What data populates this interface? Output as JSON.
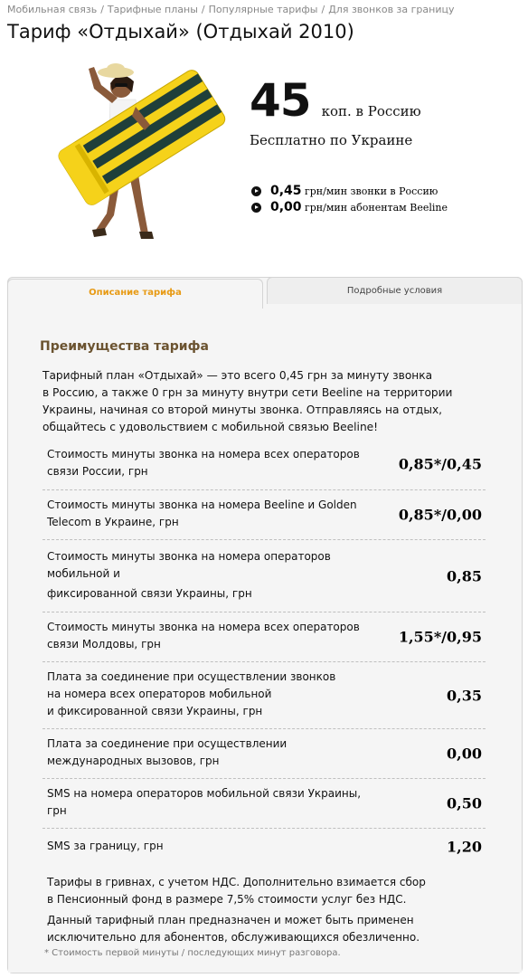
{
  "breadcrumb": [
    "Мобильная связь",
    "Тарифные планы",
    "Популярные тарифы",
    "Для звонков за границу"
  ],
  "breadcrumb_separator": "/",
  "title": "Тариф «Отдыхай» (Отдыхай 2010)",
  "hero": {
    "price": "45",
    "price_unit": "коп. в  Россию",
    "free_text": "Бесплатно по Украине"
  },
  "rates": [
    {
      "value": "0,45",
      "desc": "грн/мин звонки в Россию"
    },
    {
      "value": "0,00",
      "desc": "грн/мин абонентам Beeline"
    }
  ],
  "tabs": [
    {
      "label": "Описание тарифа",
      "active": true
    },
    {
      "label": "Подробные условия",
      "active": false
    }
  ],
  "section_title": "Преимущества тарифа",
  "intro_lines": [
    "Тарифный план «Отдыхай» — это всего 0,45 грн за минуту звонка",
    "в Россию, а также 0 грн за минуту внутри сети Beeline на территории",
    "Украины, начиная со второй минуты звонка. Отправляясь на отдых,",
    "общайтесь с удовольствием с мобильной связью Beeline!"
  ],
  "tariff_rows": [
    {
      "lines": [
        "Стоимость минуты звонка на номера всех операторов",
        "связи России, грн"
      ],
      "value": "0,85*/0,45"
    },
    {
      "lines": [
        "Стоимость минуты звонка на номера Beeline и Golden",
        "Telecom в Украине, грн"
      ],
      "value": "0,85*/0,00"
    },
    {
      "lines": [
        "Стоимость минуты звонка на номера операторов",
        "мобильной и",
        "фиксированной связи Украины, грн"
      ],
      "value": "0,85"
    },
    {
      "lines": [
        "Стоимость минуты звонка на номера всех операторов",
        "связи Молдовы, грн"
      ],
      "value": "1,55*/0,95"
    },
    {
      "lines": [
        "Плата за соединение при осуществлении звонков",
        "на номера всех операторов мобильной",
        "и фиксированной связи Украины, грн"
      ],
      "value": "0,35"
    },
    {
      "lines": [
        "Плата за соединение при осуществлении",
        "международных вызовов, грн"
      ],
      "value": "0,00"
    },
    {
      "lines": [
        "SMS на номера операторов мобильной связи Украины,",
        "грн"
      ],
      "value": "0,50"
    },
    {
      "lines": [
        "SMS за границу, грн"
      ],
      "value": "1,20"
    }
  ],
  "note1": [
    "Тарифы в гривнах, с учетом НДС. Дополнительно взимается сбор",
    "в Пенсионный фонд в размере 7,5% стоимости услуг без НДС."
  ],
  "note2": [
    "Данный тарифный план предназначен и может быть применен",
    "исключительно для абонентов, обслуживающихся обезличенно."
  ],
  "footnote": "* Стоимость первой минуты / последующих минут разговора.",
  "colors": {
    "accent": "#e79a14",
    "section_title": "#6b5330",
    "mattress_yellow": "#f5d21a"
  }
}
